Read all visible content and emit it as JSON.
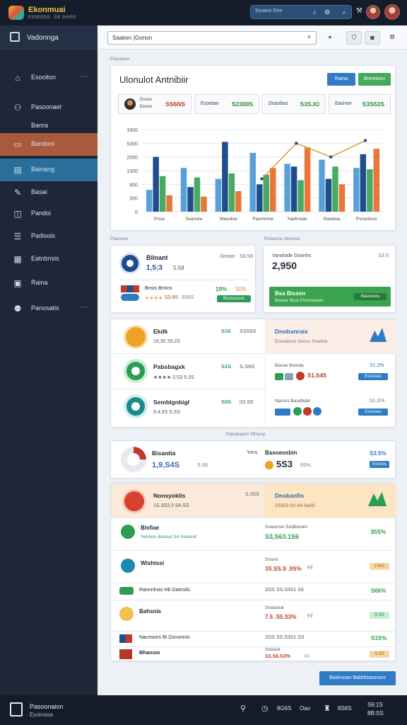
{
  "app": {
    "title": "Ekonmuai",
    "subtitle": "ESSEESO · EK GHISS",
    "search_placeholder": "Ssnaos Gnn",
    "bottom_title": "Pasoonaion",
    "bottom_subtitle": "Esoinasa",
    "bottom_items": [
      "8G6S",
      "Oao",
      "8S6S",
      "S6:1S",
      "8B:SS"
    ]
  },
  "sidebar": {
    "header": "Vadonnga",
    "items": [
      {
        "label": "Esooiton",
        "icon": "home-icon",
        "more": "···"
      },
      {
        "label": "Pasoonaet",
        "icon": "user-gear-icon"
      },
      {
        "label": "Banra",
        "icon": "flag-icon"
      },
      {
        "label": "Bandoni",
        "icon": "folder-icon"
      },
      {
        "label": "Bainang",
        "icon": "layers-icon"
      },
      {
        "label": "Basai",
        "icon": "tag-icon"
      },
      {
        "label": "Pandoi",
        "icon": "chart-icon"
      },
      {
        "label": "Padisois",
        "icon": "list-icon"
      },
      {
        "label": "Eatnbnsis",
        "icon": "grid-icon"
      },
      {
        "label": "Raina",
        "icon": "box-icon"
      },
      {
        "label": "Panosatis",
        "icon": "people-icon",
        "more": "···"
      }
    ]
  },
  "toolbar": {
    "search_value": "Saaken )Gonon",
    "caret": "✕"
  },
  "analytics": {
    "section_label": "Pasoiaon",
    "title": "Ulonulot Antnibiir",
    "btn_primary": "Raina",
    "btn_secondary": "Bonetoon",
    "kpis": [
      {
        "l1": "Dsoos",
        "l2": "Eesoo",
        "value": "SS6NS"
      },
      {
        "label": "Esoetan",
        "value": "S2300S"
      },
      {
        "label": "Dsanbos",
        "value": "S3S.IO"
      },
      {
        "label": "Easnon",
        "value": "S3S53S"
      }
    ]
  },
  "chart_data": {
    "type": "bar",
    "categories": [
      "Pnsa",
      "Ssanota",
      "Masoloa",
      "Pasmrone",
      "Nadnsian",
      "Nasetsa",
      "Psnsoisos"
    ],
    "y_ticks": [
      "0",
      "300",
      "900",
      "1500",
      "2000",
      "5300",
      "3300"
    ],
    "ylim": [
      0,
      6
    ],
    "series": [
      {
        "color": "#5aa0d8",
        "values": [
          1.6,
          3.2,
          2.4,
          4.3,
          3.5,
          3.8,
          3.2
        ]
      },
      {
        "color": "#1e4f8c",
        "values": [
          4.0,
          1.8,
          5.1,
          2.0,
          3.3,
          2.4,
          4.2
        ]
      },
      {
        "color": "#4aaa62",
        "values": [
          2.6,
          2.5,
          2.8,
          2.7,
          2.3,
          3.3,
          3.1
        ]
      },
      {
        "color": "#e8773b",
        "values": [
          1.2,
          1.1,
          1.5,
          3.2,
          4.7,
          2.0,
          4.6
        ]
      }
    ],
    "line": {
      "color": "#d99a3a",
      "values": [
        null,
        null,
        null,
        2.4,
        5.0,
        4.0,
        5.2
      ]
    }
  },
  "panel_a": {
    "section_label": "Pasoono",
    "section_label_right": "Posasna Sinsoos",
    "item1": {
      "title": "Bilnant",
      "value": "1,5;3 ",
      "sub": "5.58",
      "right_a": "Sinsoo",
      "right_b": "S6:S6"
    },
    "item2": {
      "label": "Bnsis Bnsns",
      "pct": "19%",
      "value": "S0S",
      "stars": "★★★★",
      "rating": "S3.9S",
      "count": "5S6S",
      "button": "Bosnsaono"
    },
    "right": {
      "title": "Vandoide Goonhs",
      "meta": "S3:S",
      "value": "2,950",
      "banner_title": "Bea Bissen",
      "banner_sub": "Baaoe Bisa Ehonreaoio",
      "banner_btn": "Bassonos"
    }
  },
  "panel_b": {
    "rows": [
      {
        "title": "Ekdk",
        "sub": "16,30 29.2S",
        "v1": "S16",
        "v2": "S3S6S"
      },
      {
        "title": "Pabsbagxk",
        "sub": "★★★★ 3.S3 5.3S",
        "v1": "S1S",
        "v2": "S.S6S"
      },
      {
        "title": "Semblgnbigl",
        "sub": "9.4,9S S.SS",
        "v1": "S0S",
        "v2": "03.S0"
      }
    ],
    "right": {
      "title": "Dnobanrais",
      "sub": "Eooodnsis Sesso Soarbie",
      "r1_label": "Banse Bstnda",
      "r1_pct": "S1.3%",
      "r1_value": "S1,S4S",
      "r1_pill": "Esonoas",
      "r2_label": "Nasnrs Baodbdet",
      "r2_pct": "S1,S%",
      "r2_pill": "Esonoas"
    }
  },
  "panel_c": {
    "section_label": "Pasoloaion Sfinsny",
    "top": {
      "title": "Bisantta",
      "value": "1,9,S4S",
      "sub": "S.S6",
      "right_label": "Yons",
      "right_title": "Basoeosbin",
      "right_value": "5S3",
      "right_sub": "5S%",
      "right_pct": "S3.5%",
      "right_pill": "Eosnos"
    },
    "hl": {
      "title": "Nonsyoklis",
      "sub": "1S.3S3.3 S4.SS",
      "meta": "S,S6S",
      "right_title": "Dnokanfis",
      "right_sub": "2S3S3 S0.S4 Sa0S"
    },
    "rows": [
      {
        "title": "Bisfiae",
        "sub": "Senhon Betasd S4 Sisdeoit",
        "r_label": "Ssiasnsis Sodbisoen",
        "r_value": "S3,S63.1S6",
        "r_pct": "$5S%",
        "color": "#2e9c55"
      },
      {
        "title": "Wishtosi",
        "sub": "",
        "r_label": "Sosno",
        "r_value": "3S.SS.S .9S%",
        "r_suffix": "Fil",
        "r_pct": "1S6S",
        "color": "#e8a33b"
      },
      {
        "title": "Rannnhsio Hb Gatnsilo",
        "sub": "",
        "r_label": "2OS SS.S3S1 S6",
        "r_value": "",
        "r_pct": "S66%",
        "color": "#2e9c55"
      },
      {
        "title": "Bahsnis",
        "sub": "",
        "r_label": "Soaiasiat",
        "r_value": "7.5 .S5.S3% ",
        "r_suffix": "Fil",
        "r_pct": "S.SS",
        "color": "#2e9c55"
      },
      {
        "title": "Nacnsons Bi Gsnonnio",
        "sub": "",
        "r_label": "2OS SS.S3S1 SS",
        "r_value": "",
        "r_pct": "S1S%",
        "color": "#2e9c55"
      },
      {
        "title": "Bhansio",
        "sub": "",
        "r_label": "Soiasiat",
        "r_value": "S3.S6.S3% ",
        "r_suffix": "Fil",
        "r_pct": "S.SS",
        "color": "#e8a33b"
      }
    ],
    "action": "Bashnoan Babhbiasmons"
  }
}
